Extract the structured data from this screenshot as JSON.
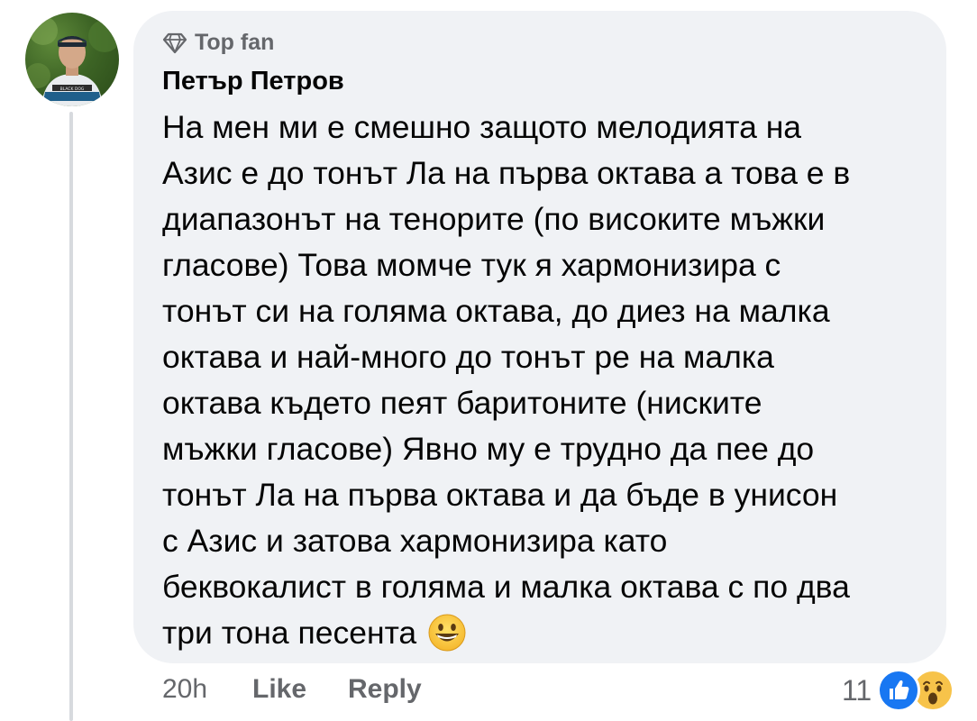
{
  "comment": {
    "badge": "Top fan",
    "badge_icon": "diamond-icon",
    "author": "Петър Петров",
    "lines": [
      "На мен ми е смешно защото мелодията на",
      "Азис е до тонът Ла на първа октава а това е в",
      "диапазонът на тенорите (по високите мъжки",
      "гласове) Това момче тук я хармонизира с",
      "тонът си на голяма октава, до диез на малка",
      "октава и най-много до тонът ре на малка",
      "октава където пеят баритоните (ниските",
      "мъжки гласове) Явно му е трудно да пее до",
      "тонът Ла на първа октава и да бъде в унисон",
      "с Азис и затова хармонизира като",
      "беквокалист в голяма и малка октава с по два",
      "три тона песента"
    ],
    "emoji": "grinning-face-emoji",
    "avatar_print": "BLACK DOG"
  },
  "actions": {
    "time": "20h",
    "like_label": "Like",
    "reply_label": "Reply"
  },
  "reactions": {
    "count": "11",
    "types": [
      "like-icon",
      "wow-icon"
    ],
    "like_color": "#1877f2",
    "wow_color": "#f7c34a"
  },
  "colors": {
    "bubble": "#f0f2f5",
    "text": "#050505",
    "secondary": "#65676b",
    "thread_line": "#d7dade"
  }
}
